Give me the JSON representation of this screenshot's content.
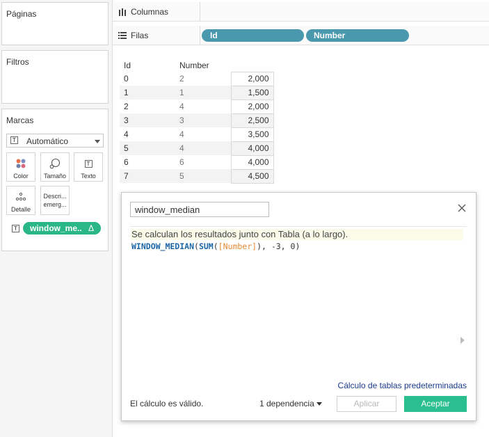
{
  "left_panel": {
    "pages": {
      "title": "Páginas"
    },
    "filters": {
      "title": "Filtros"
    },
    "marks": {
      "title": "Marcas",
      "mark_type": "Automático",
      "buttons": {
        "color": "Color",
        "size": "Tamaño",
        "text": "Texto",
        "detail": "Detalle",
        "tooltip_line1": "Descri...",
        "tooltip_line2": "emerg..."
      },
      "pill": {
        "label": "window_me..",
        "delta_icon": "Δ",
        "color": "#2bb687"
      }
    }
  },
  "shelves": {
    "columns": {
      "label": "Columnas",
      "icon": "columns-icon"
    },
    "rows": {
      "label": "Filas",
      "icon": "rows-icon",
      "pills": [
        {
          "label": "Id",
          "color": "#4a98ad"
        },
        {
          "label": "Number",
          "color": "#4a98ad"
        }
      ]
    }
  },
  "table": {
    "headers": [
      "Id",
      "Number"
    ],
    "rows": [
      {
        "id": "0",
        "number": "2",
        "value": "2,000"
      },
      {
        "id": "1",
        "number": "1",
        "value": "1,500"
      },
      {
        "id": "2",
        "number": "4",
        "value": "2,000"
      },
      {
        "id": "3",
        "number": "3",
        "value": "2,500"
      },
      {
        "id": "4",
        "number": "4",
        "value": "3,500"
      },
      {
        "id": "5",
        "number": "4",
        "value": "4,000"
      },
      {
        "id": "6",
        "number": "6",
        "value": "4,000"
      },
      {
        "id": "7",
        "number": "5",
        "value": "4,500"
      }
    ]
  },
  "dialog": {
    "name": "window_median",
    "info": "Se calculan los resultados junto con Tabla (a lo largo).",
    "formula": {
      "function": "WINDOW_MEDIAN",
      "open": "(",
      "agg": "SUM",
      "agg_open": "(",
      "field": "[Number]",
      "rest": "), -3, 0)"
    },
    "default_link": "Cálculo de tablas predeterminadas",
    "status": "El cálculo es válido.",
    "dependencies": "1 dependencia",
    "apply": "Aplicar",
    "accept": "Aceptar",
    "accent_color": "#2bbf8f"
  }
}
